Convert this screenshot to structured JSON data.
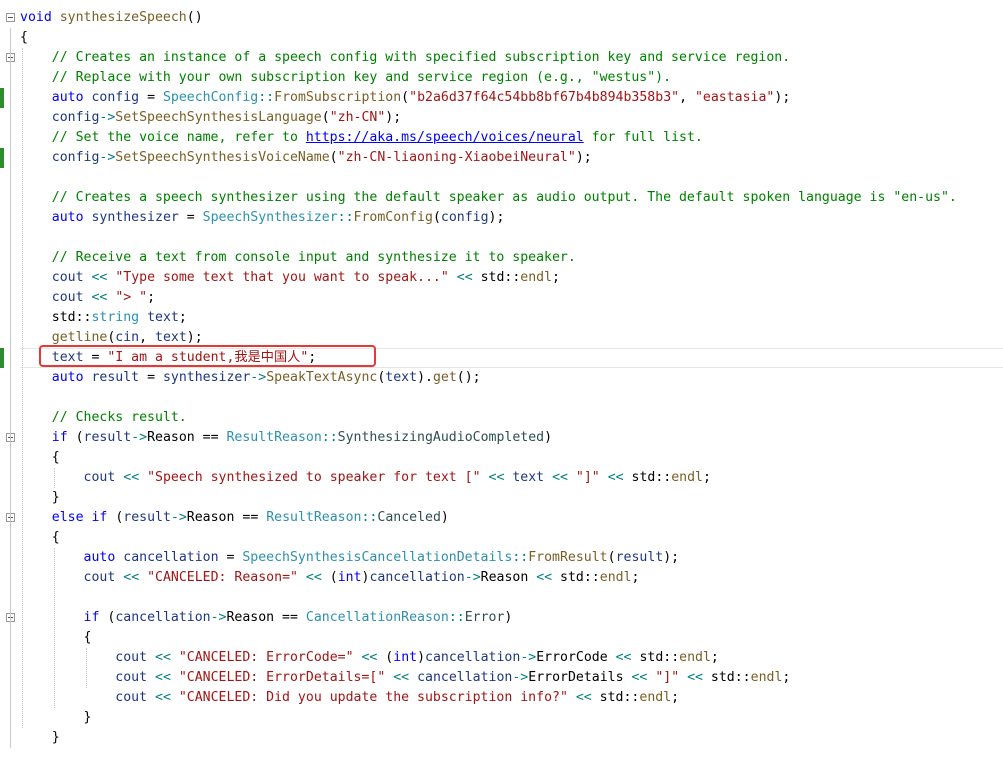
{
  "editor": {
    "lines": [
      [
        {
          "t": "void",
          "c": "kw"
        },
        {
          "t": " "
        },
        {
          "t": "synthesizeSpeech",
          "c": "fn"
        },
        {
          "t": "()"
        }
      ],
      [
        {
          "t": "{"
        }
      ],
      [
        {
          "t": "    "
        },
        {
          "t": "// Creates an instance of a speech config with specified subscription key and service region.",
          "c": "cm"
        }
      ],
      [
        {
          "t": "    "
        },
        {
          "t": "// Replace with your own subscription key and service region (e.g., \"westus\").",
          "c": "cm"
        }
      ],
      [
        {
          "t": "    "
        },
        {
          "t": "auto",
          "c": "kw"
        },
        {
          "t": " "
        },
        {
          "t": "config",
          "c": "va"
        },
        {
          "t": " = "
        },
        {
          "t": "SpeechConfig",
          "c": "ty"
        },
        {
          "t": "::",
          "c": "op"
        },
        {
          "t": "FromSubscription",
          "c": "fn"
        },
        {
          "t": "("
        },
        {
          "t": "\"b2a6d37f64c54bb8bf67b4b894b358b3\"",
          "c": "st"
        },
        {
          "t": ", "
        },
        {
          "t": "\"eastasia\"",
          "c": "st"
        },
        {
          "t": ");"
        }
      ],
      [
        {
          "t": "    "
        },
        {
          "t": "config",
          "c": "va"
        },
        {
          "t": "->",
          "c": "op"
        },
        {
          "t": "SetSpeechSynthesisLanguage",
          "c": "fn"
        },
        {
          "t": "("
        },
        {
          "t": "\"zh-CN\"",
          "c": "st"
        },
        {
          "t": ");"
        }
      ],
      [
        {
          "t": "    "
        },
        {
          "t": "// Set the voice name, refer to ",
          "c": "cm"
        },
        {
          "t": "https://aka.ms/speech/voices/neural",
          "c": "url"
        },
        {
          "t": " for full list.",
          "c": "cm"
        }
      ],
      [
        {
          "t": "    "
        },
        {
          "t": "config",
          "c": "va"
        },
        {
          "t": "->",
          "c": "op"
        },
        {
          "t": "SetSpeechSynthesisVoiceName",
          "c": "fn"
        },
        {
          "t": "("
        },
        {
          "t": "\"zh-CN-liaoning-XiaobeiNeural\"",
          "c": "st"
        },
        {
          "t": ");"
        }
      ],
      [],
      [
        {
          "t": "    "
        },
        {
          "t": "// Creates a speech synthesizer using the default speaker as audio output. The default spoken language is \"en-us\".",
          "c": "cm"
        }
      ],
      [
        {
          "t": "    "
        },
        {
          "t": "auto",
          "c": "kw"
        },
        {
          "t": " "
        },
        {
          "t": "synthesizer",
          "c": "va"
        },
        {
          "t": " = "
        },
        {
          "t": "SpeechSynthesizer",
          "c": "ty"
        },
        {
          "t": "::",
          "c": "op"
        },
        {
          "t": "FromConfig",
          "c": "fn"
        },
        {
          "t": "("
        },
        {
          "t": "config",
          "c": "va"
        },
        {
          "t": ");"
        }
      ],
      [],
      [
        {
          "t": "    "
        },
        {
          "t": "// Receive a text from console input and synthesize it to speaker.",
          "c": "cm"
        }
      ],
      [
        {
          "t": "    "
        },
        {
          "t": "cout",
          "c": "va"
        },
        {
          "t": " "
        },
        {
          "t": "<<",
          "c": "op"
        },
        {
          "t": " "
        },
        {
          "t": "\"Type some text that you want to speak...\"",
          "c": "st"
        },
        {
          "t": " "
        },
        {
          "t": "<<",
          "c": "op"
        },
        {
          "t": " std::"
        },
        {
          "t": "endl",
          "c": "fn"
        },
        {
          "t": ";"
        }
      ],
      [
        {
          "t": "    "
        },
        {
          "t": "cout",
          "c": "va"
        },
        {
          "t": " "
        },
        {
          "t": "<<",
          "c": "op"
        },
        {
          "t": " "
        },
        {
          "t": "\"> \"",
          "c": "st"
        },
        {
          "t": ";"
        }
      ],
      [
        {
          "t": "    std::"
        },
        {
          "t": "string",
          "c": "ty"
        },
        {
          "t": " "
        },
        {
          "t": "text",
          "c": "va"
        },
        {
          "t": ";"
        }
      ],
      [
        {
          "t": "    "
        },
        {
          "t": "getline",
          "c": "fn"
        },
        {
          "t": "("
        },
        {
          "t": "cin",
          "c": "va"
        },
        {
          "t": ", "
        },
        {
          "t": "text",
          "c": "va"
        },
        {
          "t": ");"
        }
      ],
      [
        {
          "t": "    "
        },
        {
          "t": "text",
          "c": "va"
        },
        {
          "t": " = "
        },
        {
          "t": "\"I am a student,我是中国人\"",
          "c": "st"
        },
        {
          "t": ";"
        }
      ],
      [
        {
          "t": "    "
        },
        {
          "t": "auto",
          "c": "kw"
        },
        {
          "t": " "
        },
        {
          "t": "result",
          "c": "va"
        },
        {
          "t": " = "
        },
        {
          "t": "synthesizer",
          "c": "va"
        },
        {
          "t": "->",
          "c": "op"
        },
        {
          "t": "SpeakTextAsync",
          "c": "fn"
        },
        {
          "t": "("
        },
        {
          "t": "text",
          "c": "va"
        },
        {
          "t": ")."
        },
        {
          "t": "get",
          "c": "fn"
        },
        {
          "t": "();"
        }
      ],
      [],
      [
        {
          "t": "    "
        },
        {
          "t": "// Checks result.",
          "c": "cm"
        }
      ],
      [
        {
          "t": "    "
        },
        {
          "t": "if",
          "c": "kw"
        },
        {
          "t": " ("
        },
        {
          "t": "result",
          "c": "va"
        },
        {
          "t": "->",
          "c": "op"
        },
        {
          "t": "Reason == "
        },
        {
          "t": "ResultReason",
          "c": "ty"
        },
        {
          "t": "::",
          "c": "op"
        },
        {
          "t": "SynthesizingAudioCompleted",
          "c": "en"
        },
        {
          "t": ")"
        }
      ],
      [
        {
          "t": "    {"
        }
      ],
      [
        {
          "t": "        "
        },
        {
          "t": "cout",
          "c": "va"
        },
        {
          "t": " "
        },
        {
          "t": "<<",
          "c": "op"
        },
        {
          "t": " "
        },
        {
          "t": "\"Speech synthesized to speaker for text [\"",
          "c": "st"
        },
        {
          "t": " "
        },
        {
          "t": "<<",
          "c": "op"
        },
        {
          "t": " "
        },
        {
          "t": "text",
          "c": "va"
        },
        {
          "t": " "
        },
        {
          "t": "<<",
          "c": "op"
        },
        {
          "t": " "
        },
        {
          "t": "\"]\"",
          "c": "st"
        },
        {
          "t": " "
        },
        {
          "t": "<<",
          "c": "op"
        },
        {
          "t": " std::"
        },
        {
          "t": "endl",
          "c": "fn"
        },
        {
          "t": ";"
        }
      ],
      [
        {
          "t": "    }"
        }
      ],
      [
        {
          "t": "    "
        },
        {
          "t": "else",
          "c": "kw"
        },
        {
          "t": " "
        },
        {
          "t": "if",
          "c": "kw"
        },
        {
          "t": " ("
        },
        {
          "t": "result",
          "c": "va"
        },
        {
          "t": "->",
          "c": "op"
        },
        {
          "t": "Reason == "
        },
        {
          "t": "ResultReason",
          "c": "ty"
        },
        {
          "t": "::",
          "c": "op"
        },
        {
          "t": "Canceled",
          "c": "en"
        },
        {
          "t": ")"
        }
      ],
      [
        {
          "t": "    {"
        }
      ],
      [
        {
          "t": "        "
        },
        {
          "t": "auto",
          "c": "kw"
        },
        {
          "t": " "
        },
        {
          "t": "cancellation",
          "c": "va"
        },
        {
          "t": " = "
        },
        {
          "t": "SpeechSynthesisCancellationDetails",
          "c": "ty"
        },
        {
          "t": "::",
          "c": "op"
        },
        {
          "t": "FromResult",
          "c": "fn"
        },
        {
          "t": "("
        },
        {
          "t": "result",
          "c": "va"
        },
        {
          "t": ");"
        }
      ],
      [
        {
          "t": "        "
        },
        {
          "t": "cout",
          "c": "va"
        },
        {
          "t": " "
        },
        {
          "t": "<<",
          "c": "op"
        },
        {
          "t": " "
        },
        {
          "t": "\"CANCELED: Reason=\"",
          "c": "st"
        },
        {
          "t": " "
        },
        {
          "t": "<<",
          "c": "op"
        },
        {
          "t": " ("
        },
        {
          "t": "int",
          "c": "kw"
        },
        {
          "t": ")"
        },
        {
          "t": "cancellation",
          "c": "va"
        },
        {
          "t": "->",
          "c": "op"
        },
        {
          "t": "Reason "
        },
        {
          "t": "<<",
          "c": "op"
        },
        {
          "t": " std::"
        },
        {
          "t": "endl",
          "c": "fn"
        },
        {
          "t": ";"
        }
      ],
      [],
      [
        {
          "t": "        "
        },
        {
          "t": "if",
          "c": "kw"
        },
        {
          "t": " ("
        },
        {
          "t": "cancellation",
          "c": "va"
        },
        {
          "t": "->",
          "c": "op"
        },
        {
          "t": "Reason == "
        },
        {
          "t": "CancellationReason",
          "c": "ty"
        },
        {
          "t": "::",
          "c": "op"
        },
        {
          "t": "Error",
          "c": "en"
        },
        {
          "t": ")"
        }
      ],
      [
        {
          "t": "        {"
        }
      ],
      [
        {
          "t": "            "
        },
        {
          "t": "cout",
          "c": "va"
        },
        {
          "t": " "
        },
        {
          "t": "<<",
          "c": "op"
        },
        {
          "t": " "
        },
        {
          "t": "\"CANCELED: ErrorCode=\"",
          "c": "st"
        },
        {
          "t": " "
        },
        {
          "t": "<<",
          "c": "op"
        },
        {
          "t": " ("
        },
        {
          "t": "int",
          "c": "kw"
        },
        {
          "t": ")"
        },
        {
          "t": "cancellation",
          "c": "va"
        },
        {
          "t": "->",
          "c": "op"
        },
        {
          "t": "ErrorCode "
        },
        {
          "t": "<<",
          "c": "op"
        },
        {
          "t": " std::"
        },
        {
          "t": "endl",
          "c": "fn"
        },
        {
          "t": ";"
        }
      ],
      [
        {
          "t": "            "
        },
        {
          "t": "cout",
          "c": "va"
        },
        {
          "t": " "
        },
        {
          "t": "<<",
          "c": "op"
        },
        {
          "t": " "
        },
        {
          "t": "\"CANCELED: ErrorDetails=[\"",
          "c": "st"
        },
        {
          "t": " "
        },
        {
          "t": "<<",
          "c": "op"
        },
        {
          "t": " "
        },
        {
          "t": "cancellation",
          "c": "va"
        },
        {
          "t": "->",
          "c": "op"
        },
        {
          "t": "ErrorDetails "
        },
        {
          "t": "<<",
          "c": "op"
        },
        {
          "t": " "
        },
        {
          "t": "\"]\"",
          "c": "st"
        },
        {
          "t": " "
        },
        {
          "t": "<<",
          "c": "op"
        },
        {
          "t": " std::"
        },
        {
          "t": "endl",
          "c": "fn"
        },
        {
          "t": ";"
        }
      ],
      [
        {
          "t": "            "
        },
        {
          "t": "cout",
          "c": "va"
        },
        {
          "t": " "
        },
        {
          "t": "<<",
          "c": "op"
        },
        {
          "t": " "
        },
        {
          "t": "\"CANCELED: Did you update the subscription info?\"",
          "c": "st"
        },
        {
          "t": " "
        },
        {
          "t": "<<",
          "c": "op"
        },
        {
          "t": " std::"
        },
        {
          "t": "endl",
          "c": "fn"
        },
        {
          "t": ";"
        }
      ],
      [
        {
          "t": "        }"
        }
      ],
      [
        {
          "t": "    }"
        }
      ],
      []
    ],
    "fold_lines": [
      0,
      2,
      21,
      25,
      30
    ],
    "changed_lines": [
      4,
      7,
      17
    ],
    "highlighted_line": 17,
    "colors": {
      "keyword": "#0000ff",
      "type": "#2b91af",
      "comment": "#008000",
      "string": "#a31515",
      "function": "#795e26",
      "variable": "#1f377f",
      "highlight_box": "#e53935",
      "change_marker": "#2e8b2e"
    }
  }
}
